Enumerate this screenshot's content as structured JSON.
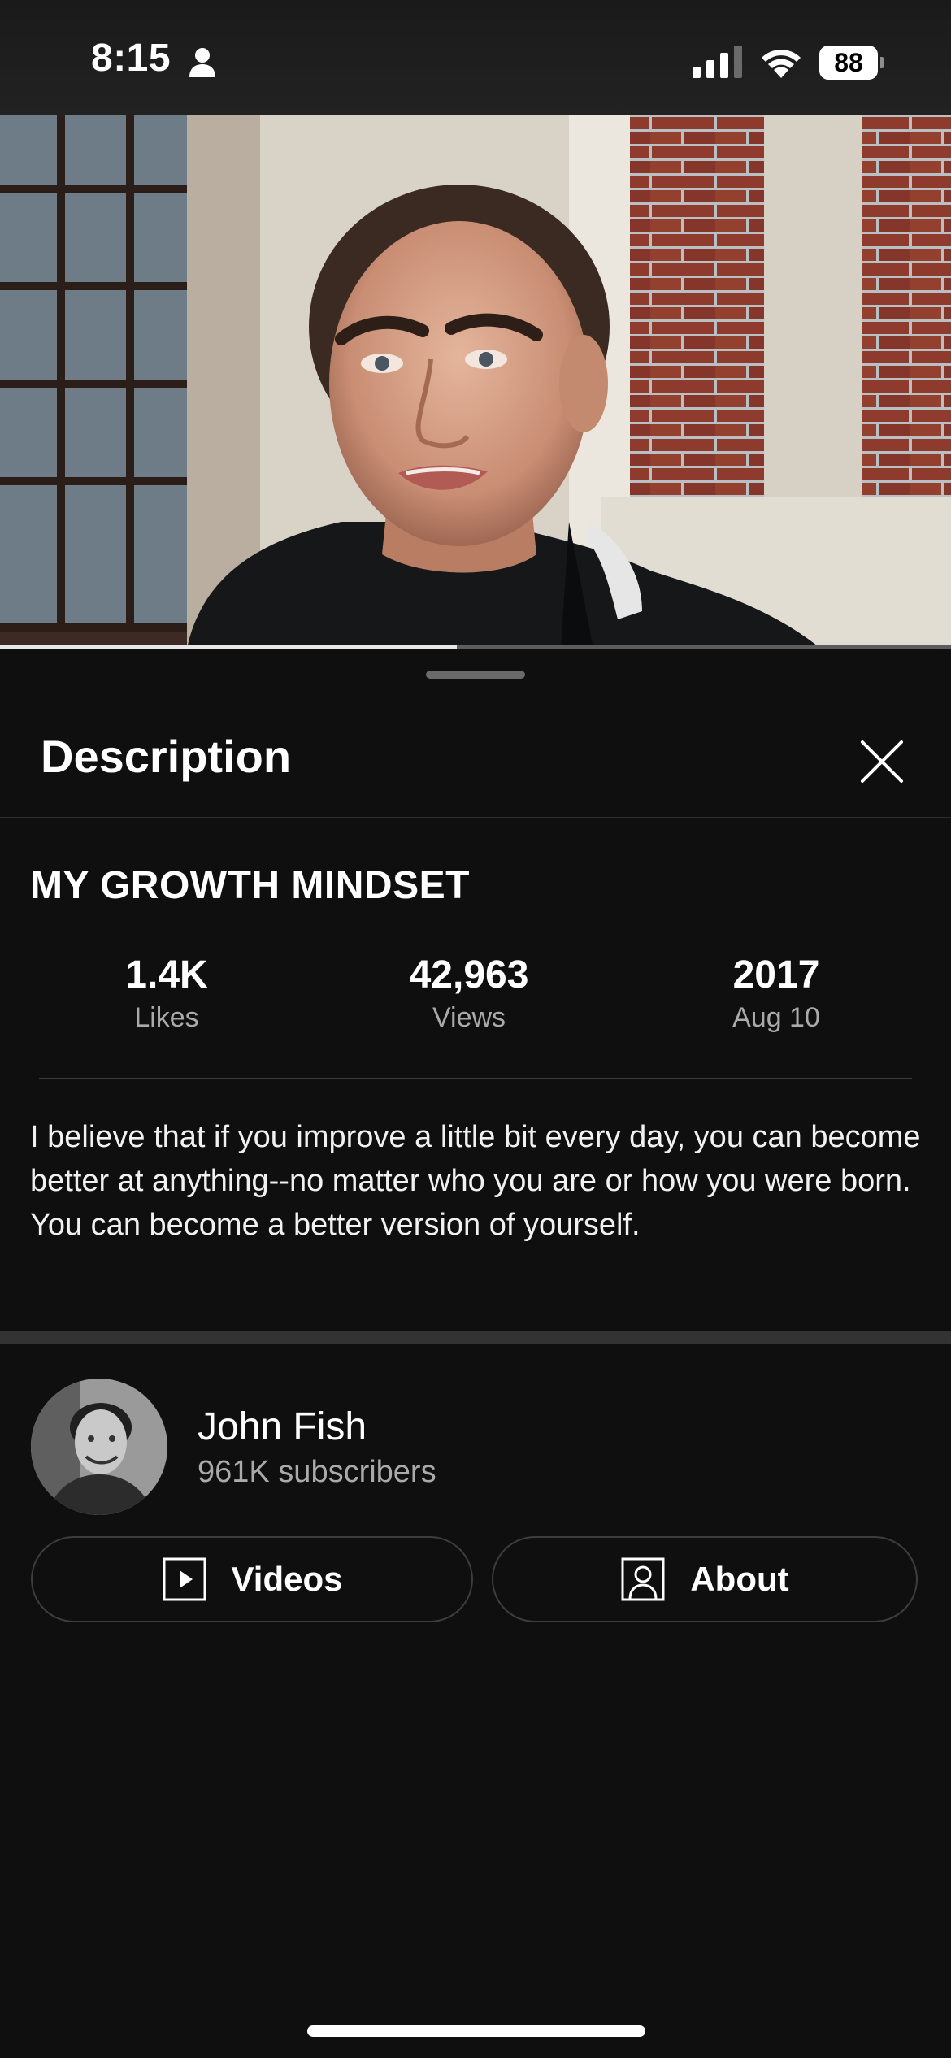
{
  "status_bar": {
    "time": "8:15",
    "battery": "88",
    "icons": [
      "person-icon",
      "cellular-signal-icon",
      "wifi-icon",
      "battery-icon"
    ]
  },
  "video": {
    "progress": 0.48
  },
  "sheet": {
    "title": "Description",
    "close_icon": "close-icon"
  },
  "video_info": {
    "title": "MY GROWTH MINDSET",
    "stats": [
      {
        "value": "1.4K",
        "label": "Likes"
      },
      {
        "value": "42,963",
        "label": "Views"
      },
      {
        "value": "2017",
        "label": "Aug 10"
      }
    ],
    "description": "I believe that if you improve a little bit every day, you can become better at anything--no matter who you are or how you were born. You can become a better version of yourself."
  },
  "channel": {
    "name": "John Fish",
    "subscribers": "961K subscribers",
    "buttons": [
      {
        "label": "Videos",
        "icon": "play-square-icon"
      },
      {
        "label": "About",
        "icon": "person-square-icon"
      }
    ]
  },
  "colors": {
    "background": "#0f0f0f",
    "divider": "#333333",
    "secondary_text": "#aaaaaa"
  }
}
